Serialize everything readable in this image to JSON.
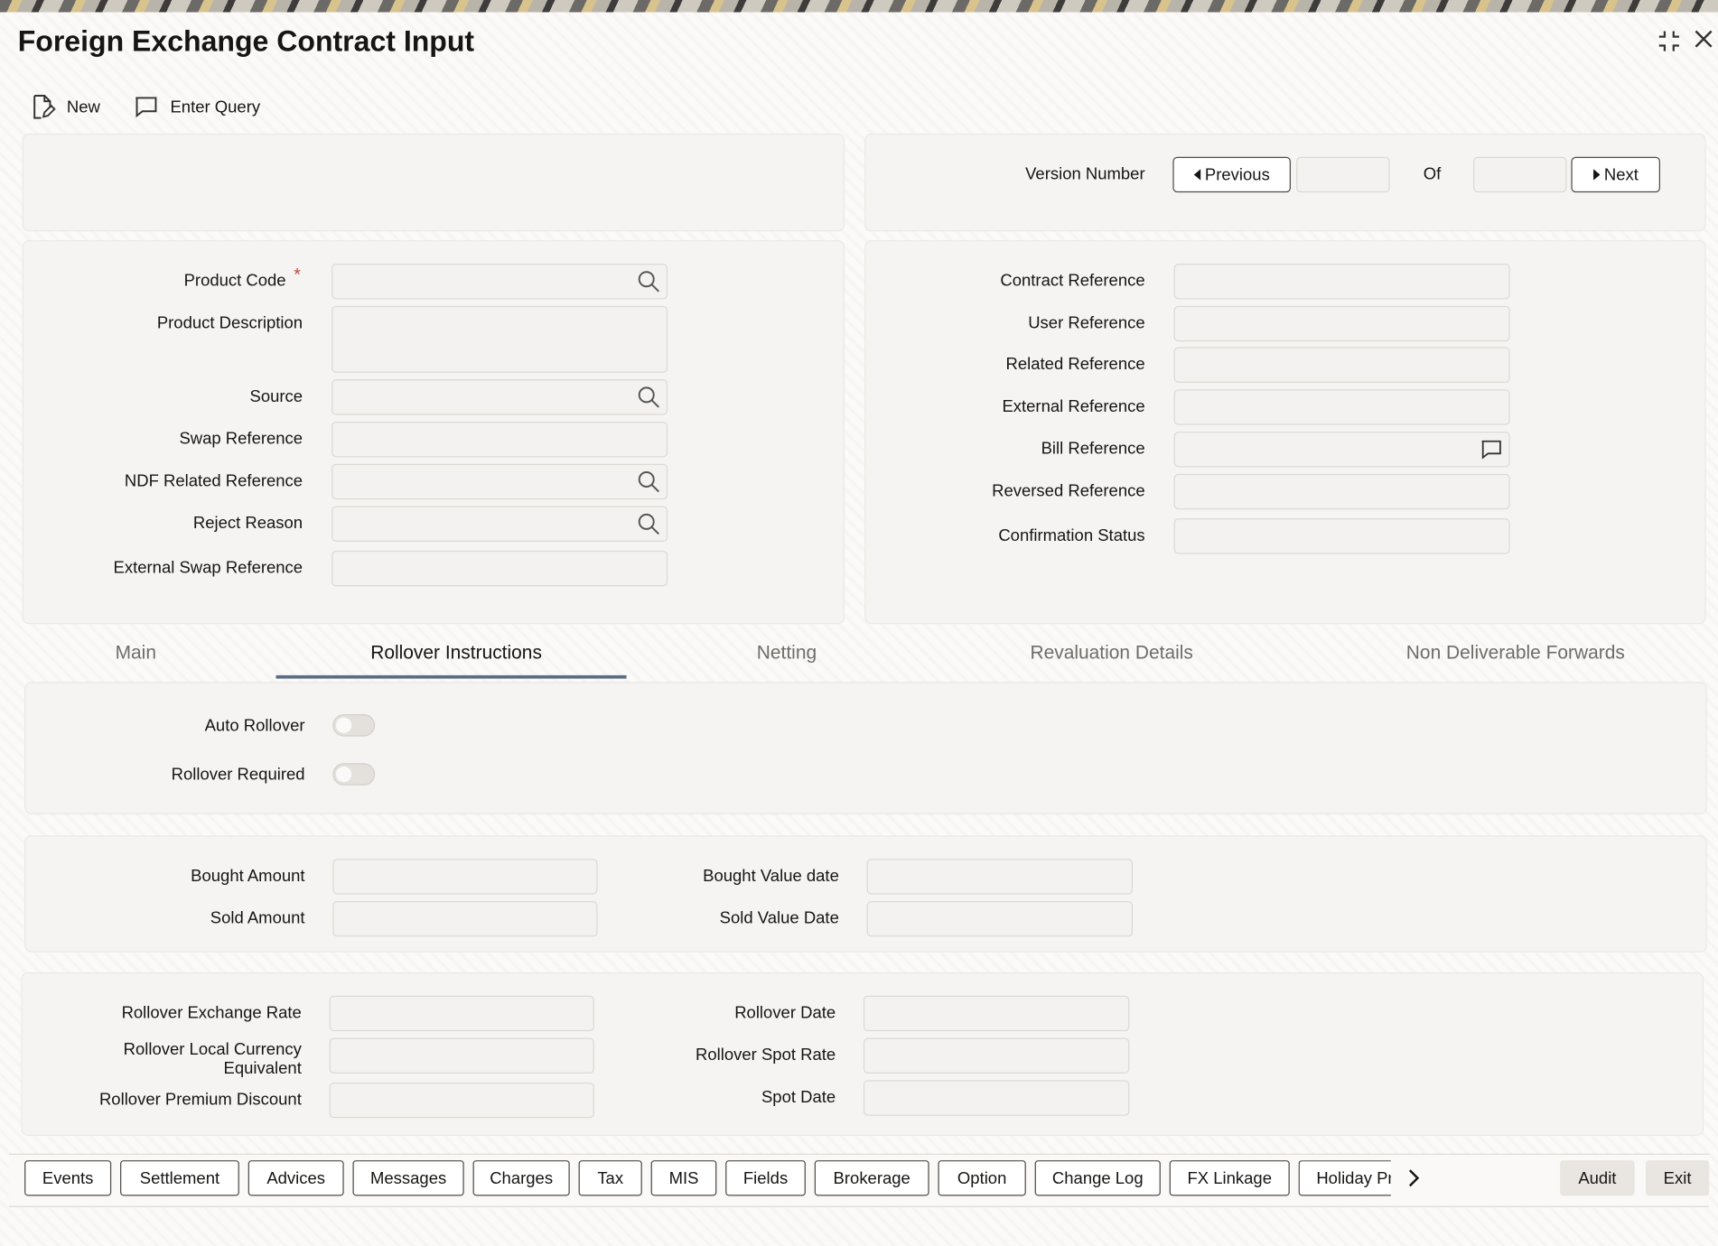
{
  "window": {
    "title": "Foreign Exchange Contract Input",
    "maximize_icon": "collapse-icon",
    "close_icon": "close-icon"
  },
  "toolbar": {
    "new_label": "New",
    "enter_query_label": "Enter Query"
  },
  "version": {
    "label": "Version Number",
    "previous_label": "Previous",
    "of_label": "Of",
    "next_label": "Next",
    "current_value": "",
    "total_value": ""
  },
  "left_form": {
    "product_code_label": "Product Code",
    "required_marker": "*",
    "product_description_label": "Product Description",
    "source_label": "Source",
    "swap_reference_label": "Swap Reference",
    "ndf_related_reference_label": "NDF Related Reference",
    "reject_reason_label": "Reject Reason",
    "external_swap_reference_label": "External Swap Reference"
  },
  "right_form": {
    "contract_reference_label": "Contract Reference",
    "user_reference_label": "User Reference",
    "related_reference_label": "Related Reference",
    "external_reference_label": "External Reference",
    "bill_reference_label": "Bill Reference",
    "reversed_reference_label": "Reversed Reference",
    "confirmation_status_label": "Confirmation Status"
  },
  "tabs": [
    {
      "label": "Main"
    },
    {
      "label": "Rollover Instructions"
    },
    {
      "label": "Netting"
    },
    {
      "label": "Revaluation Details"
    },
    {
      "label": "Non Deliverable Forwards"
    }
  ],
  "active_tab": "Rollover Instructions",
  "rollover": {
    "auto_rollover_label": "Auto Rollover",
    "auto_rollover_on": false,
    "rollover_required_label": "Rollover Required",
    "rollover_required_on": false
  },
  "amounts": {
    "bought_amount_label": "Bought Amount",
    "sold_amount_label": "Sold Amount",
    "bought_value_date_label": "Bought Value date",
    "sold_value_date_label": "Sold Value Date"
  },
  "rollover_details": {
    "exchange_rate_label": "Rollover Exchange Rate",
    "local_ccy_label_1": "Rollover Local Currency",
    "local_ccy_label_2": "Equivalent",
    "premium_discount_label": "Rollover Premium Discount",
    "rollover_date_label": "Rollover Date",
    "spot_rate_label": "Rollover Spot Rate",
    "spot_date_label": "Spot Date"
  },
  "bottom_buttons": [
    "Events",
    "Settlement",
    "Advices",
    "Messages",
    "Charges",
    "Tax",
    "MIS",
    "Fields",
    "Brokerage",
    "Option",
    "Change Log",
    "FX Linkage",
    "Holiday Pr"
  ],
  "footer": {
    "audit_label": "Audit",
    "exit_label": "Exit"
  }
}
